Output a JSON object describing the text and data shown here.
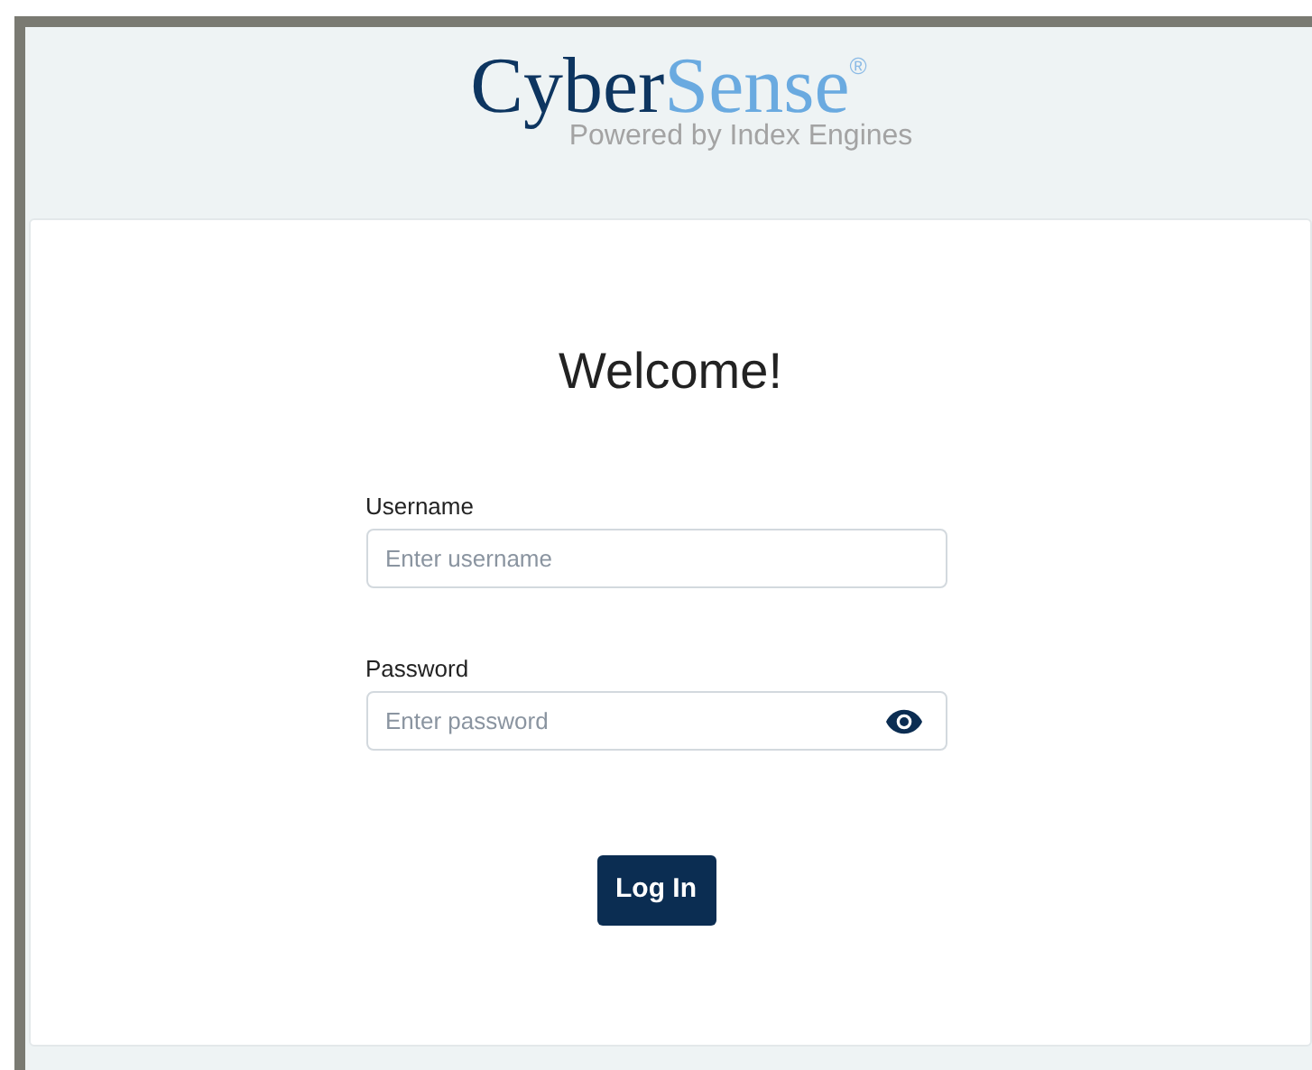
{
  "logo": {
    "primary": "Cyber",
    "accent": "Sense",
    "mark": "®",
    "tagline": "Powered by Index Engines"
  },
  "heading": "Welcome!",
  "fields": [
    {
      "label": "Username",
      "placeholder": "Enter username",
      "kind": "text"
    },
    {
      "label": "Password",
      "placeholder": "Enter password",
      "kind": "password"
    }
  ],
  "submit": "Log In"
}
